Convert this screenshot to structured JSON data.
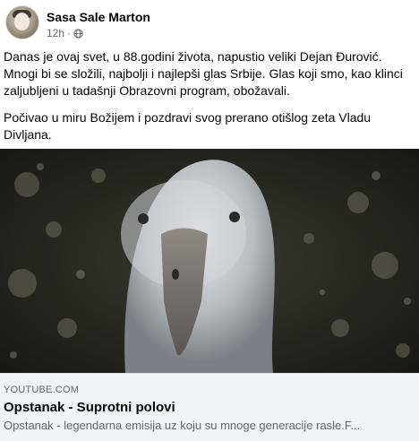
{
  "post": {
    "author": "Sasa Sale Marton",
    "time": "12h",
    "separator": "·",
    "privacy_icon": "globe-icon",
    "paragraphs": [
      "Danas je ovaj svet, u 88.godini života, napustio veliki Dejan Đurović. Mnogi bi se složili, najbolji i najlepši glas Srbije. Glas koji smo, kao klinci zaljubljeni u tadašnji Obrazovni program, obožavali.",
      "Počivao u miru Božijem i pozdravi svog prerano otišlog zeta Vladu Divljana."
    ]
  },
  "link_preview": {
    "domain": "YOUTUBE.COM",
    "title": "Opstanak - Suprotni polovi",
    "description": "Opstanak - legendarna emisija uz koju su mnoge generacije rasle.F..."
  },
  "colors": {
    "text": "#050505",
    "secondary_text": "#65676b",
    "card_background": "#f0f2f5"
  }
}
